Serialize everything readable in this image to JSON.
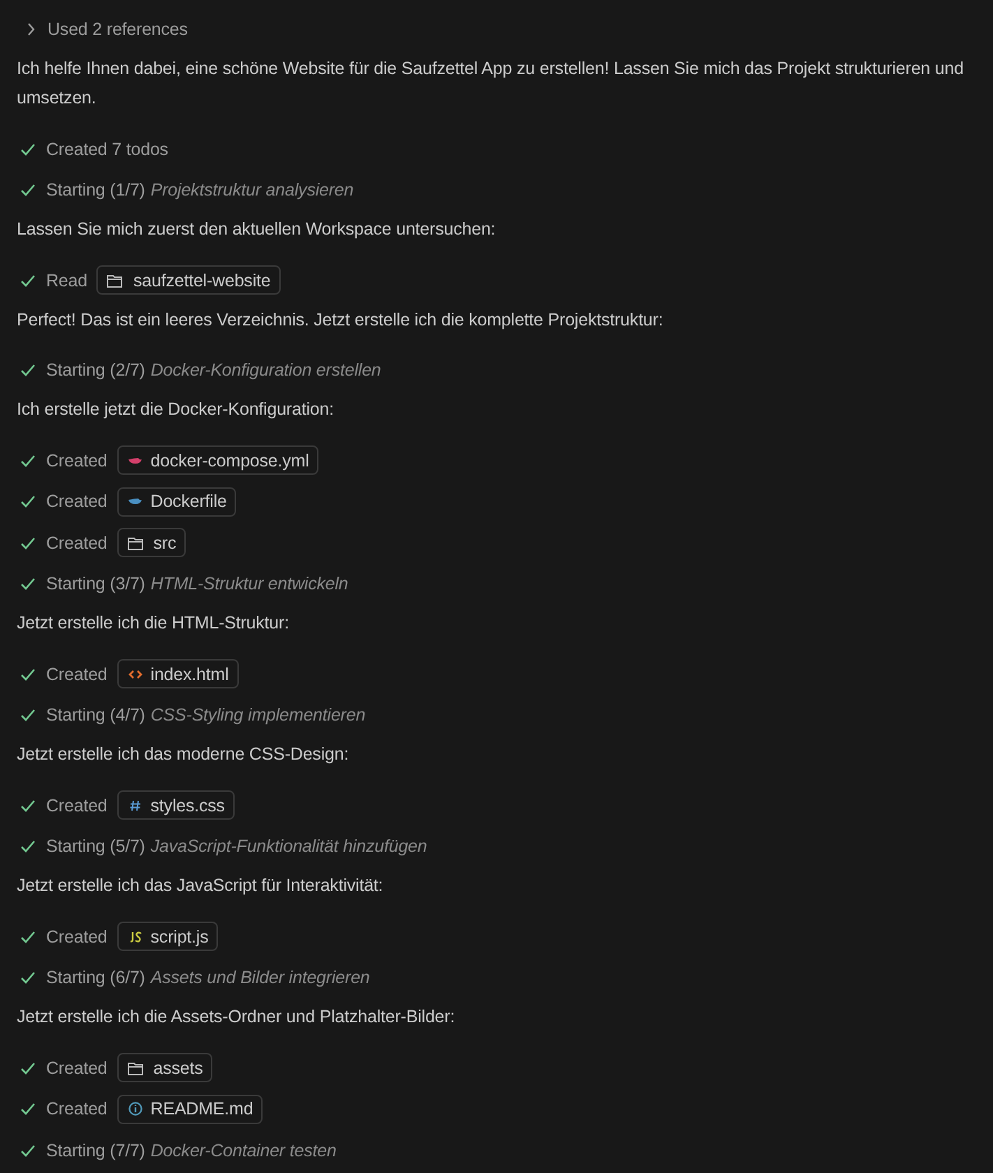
{
  "references": {
    "label": "Used 2 references",
    "expanded": false
  },
  "entries": [
    {
      "kind": "text",
      "text": "Ich helfe Ihnen dabei, eine schöne Website für die Saufzettel App zu erstellen! Lassen Sie mich das Projekt strukturieren und umsetzen."
    },
    {
      "kind": "step",
      "verb": "Created 7 todos"
    },
    {
      "kind": "step",
      "verb": "Starting (1/7)",
      "detail": "Projektstruktur analysieren"
    },
    {
      "kind": "text",
      "text": "Lassen Sie mich zuerst den aktuellen Workspace untersuchen:"
    },
    {
      "kind": "step",
      "verb": "Read",
      "file": {
        "name": "saufzettel-website",
        "kind": "folder"
      }
    },
    {
      "kind": "text",
      "text": "Perfect! Das ist ein leeres Verzeichnis. Jetzt erstelle ich die komplette Projektstruktur:"
    },
    {
      "kind": "step",
      "verb": "Starting (2/7)",
      "detail": "Docker-Konfiguration erstellen"
    },
    {
      "kind": "text",
      "text": "Ich erstelle jetzt die Docker-Konfiguration:"
    },
    {
      "kind": "step",
      "verb": "Created",
      "file": {
        "name": "docker-compose.yml",
        "kind": "compose"
      }
    },
    {
      "kind": "step",
      "verb": "Created",
      "file": {
        "name": "Dockerfile",
        "kind": "dockerfile"
      }
    },
    {
      "kind": "step",
      "verb": "Created",
      "file": {
        "name": "src",
        "kind": "folder"
      }
    },
    {
      "kind": "step",
      "verb": "Starting (3/7)",
      "detail": "HTML-Struktur entwickeln"
    },
    {
      "kind": "text",
      "text": "Jetzt erstelle ich die HTML-Struktur:"
    },
    {
      "kind": "step",
      "verb": "Created",
      "file": {
        "name": "index.html",
        "kind": "html"
      }
    },
    {
      "kind": "step",
      "verb": "Starting (4/7)",
      "detail": "CSS-Styling implementieren"
    },
    {
      "kind": "text",
      "text": "Jetzt erstelle ich das moderne CSS-Design:"
    },
    {
      "kind": "step",
      "verb": "Created",
      "file": {
        "name": "styles.css",
        "kind": "css"
      }
    },
    {
      "kind": "step",
      "verb": "Starting (5/7)",
      "detail": "JavaScript-Funktionalität hinzufügen"
    },
    {
      "kind": "text",
      "text": "Jetzt erstelle ich das JavaScript für Interaktivität:"
    },
    {
      "kind": "step",
      "verb": "Created",
      "file": {
        "name": "script.js",
        "kind": "js"
      }
    },
    {
      "kind": "step",
      "verb": "Starting (6/7)",
      "detail": "Assets und Bilder integrieren"
    },
    {
      "kind": "text",
      "text": "Jetzt erstelle ich die Assets-Ordner und Platzhalter-Bilder:"
    },
    {
      "kind": "step",
      "verb": "Created",
      "file": {
        "name": "assets",
        "kind": "folder"
      }
    },
    {
      "kind": "step",
      "verb": "Created",
      "file": {
        "name": "README.md",
        "kind": "readme"
      }
    },
    {
      "kind": "step",
      "verb": "Starting (7/7)",
      "detail": "Docker-Container testen"
    }
  ]
}
